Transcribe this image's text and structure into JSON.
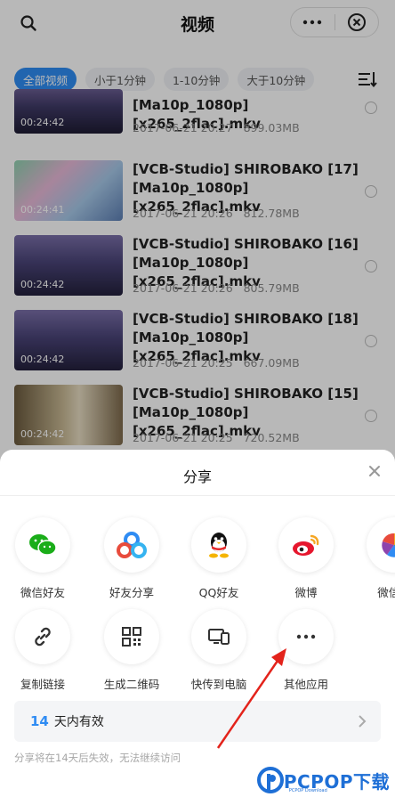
{
  "header": {
    "title": "视频"
  },
  "filters": [
    "全部视频",
    "小于1分钟",
    "1-10分钟",
    "大于10分钟"
  ],
  "videos": [
    {
      "name_line2": "[Ma10p_1080p][x265_2flac].mkv",
      "date": "2017-06-21 20:27",
      "size": "899.03MB",
      "duration": "00:24:42"
    },
    {
      "name_line1": "[VCB-Studio] SHIROBAKO [17]",
      "name_line2": "[Ma10p_1080p][x265_2flac].mkv",
      "date": "2017-06-21 20:26",
      "size": "812.78MB",
      "duration": "00:24:41"
    },
    {
      "name_line1": "[VCB-Studio] SHIROBAKO [16]",
      "name_line2": "[Ma10p_1080p][x265_2flac].mkv",
      "date": "2017-06-21 20:26",
      "size": "805.79MB",
      "duration": "00:24:42"
    },
    {
      "name_line1": "[VCB-Studio] SHIROBAKO [18]",
      "name_line2": "[Ma10p_1080p][x265_2flac].mkv",
      "date": "2017-06-21 20:25",
      "size": "667.09MB",
      "duration": "00:24:42"
    },
    {
      "name_line1": "[VCB-Studio] SHIROBAKO [15]",
      "name_line2": "[Ma10p_1080p][x265_2flac].mkv",
      "date": "2017-06-21 20:25",
      "size": "720.52MB",
      "duration": "00:24:42"
    }
  ],
  "share": {
    "title": "分享",
    "row1": [
      {
        "label": "微信好友",
        "icon": "wechat-icon"
      },
      {
        "label": "好友分享",
        "icon": "baidu-friends-icon"
      },
      {
        "label": "QQ好友",
        "icon": "qq-icon"
      },
      {
        "label": "微博",
        "icon": "weibo-icon"
      },
      {
        "label": "微信朋",
        "icon": "wechat-moments-icon"
      }
    ],
    "row2": [
      {
        "label": "复制链接",
        "icon": "link-icon"
      },
      {
        "label": "生成二维码",
        "icon": "qrcode-icon"
      },
      {
        "label": "快传到电脑",
        "icon": "devices-icon"
      },
      {
        "label": "其他应用",
        "icon": "more-icon"
      }
    ],
    "validity_days": "14",
    "validity_text": "天内有效",
    "note": "分享将在14天后失效，无法继续访问"
  },
  "watermark": {
    "text": "PCPOP下载",
    "sub": "PCPOP Download"
  },
  "colors": {
    "accent": "#2f8cf3",
    "wechat": "#1aad19",
    "weibo": "#e6162d"
  }
}
